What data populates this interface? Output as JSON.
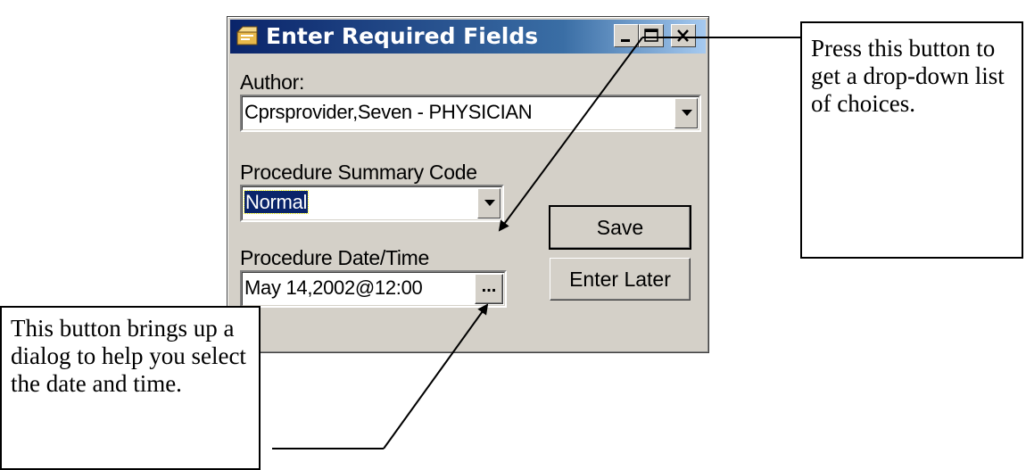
{
  "window": {
    "title": "Enter Required Fields",
    "icon": "form-window-icon",
    "caption_buttons": [
      "minimize-icon",
      "maximize-icon",
      "close-icon"
    ]
  },
  "author": {
    "label": "Author:",
    "value": "Cprsprovider,Seven - PHYSICIAN"
  },
  "procedure_summary": {
    "label": "Procedure Summary Code",
    "value": "Normal"
  },
  "procedure_datetime": {
    "label": "Procedure Date/Time",
    "value": "May 14,2002@12:00",
    "picker_label": "..."
  },
  "buttons": {
    "save": "Save",
    "enter_later": "Enter Later"
  },
  "callouts": {
    "dropdown": "Press this button to get a drop-down list of choices.",
    "date_button": "This button brings up a dialog to help you select the date and time."
  },
  "colors": {
    "titlebar_start": "#0a246a",
    "titlebar_end": "#a6caf0",
    "face": "#d4d0c8",
    "selection": "#0a246a"
  }
}
